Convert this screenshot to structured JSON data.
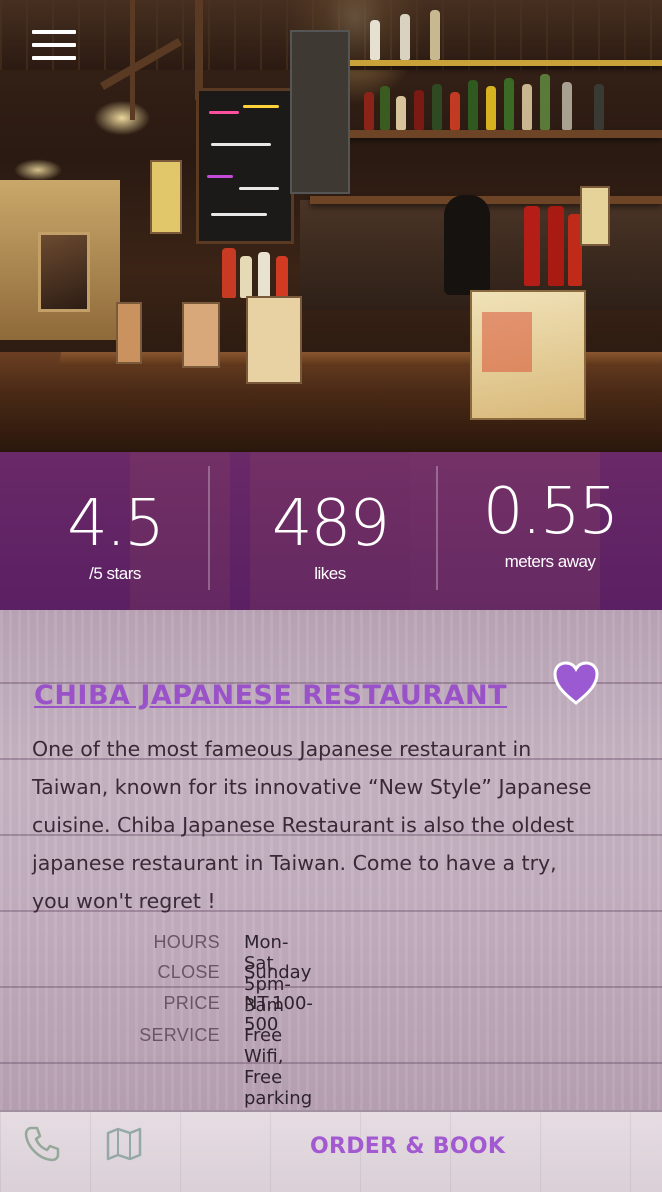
{
  "header": {
    "menu_icon": "hamburger-menu-icon"
  },
  "stats": {
    "rating": {
      "value": "4.5",
      "label": "/5 stars"
    },
    "likes": {
      "value": "489",
      "label": "likes"
    },
    "distance": {
      "value": "0.55",
      "label": "meters away"
    }
  },
  "restaurant": {
    "name": "CHIBA JAPANESE RESTAURANT",
    "favorite_icon": "heart-icon",
    "description": "One of the most fameous Japanese restaurant in Taiwan, known for its innovative “New Style” Japanese cuisine. Chiba Japanese Restaurant is also the oldest japanese restaurant in Taiwan. Come to have a try, you won't regret !",
    "info": [
      {
        "key": "HOURS",
        "value": "Mon-Sat 5pm-3am"
      },
      {
        "key": "CLOSE",
        "value": "Sunday"
      },
      {
        "key": "PRICE",
        "value": "NT.100-500"
      },
      {
        "key": "SERVICE",
        "value": "Free Wifi, Free parking"
      }
    ]
  },
  "bottom_bar": {
    "phone_icon": "phone-icon",
    "map_icon": "map-icon",
    "order_label": "ORDER & BOOK"
  },
  "colors": {
    "accent": "#9a52c8",
    "stats_overlay": "#6e2878"
  }
}
